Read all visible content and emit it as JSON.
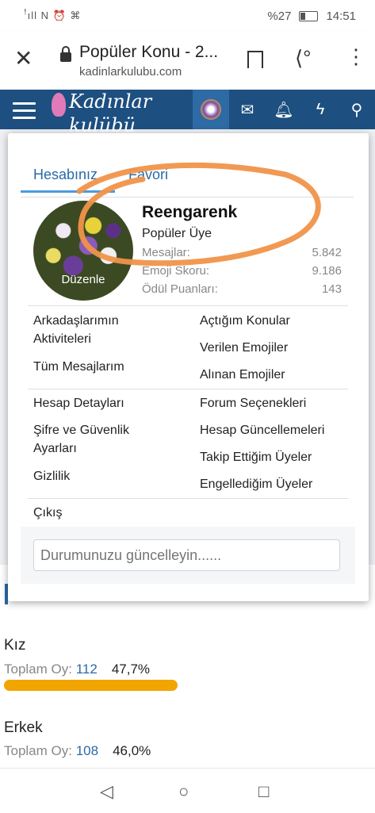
{
  "status_bar": {
    "signal": "ꜝıll N ⏰ ⌘",
    "battery": "%27",
    "time": "14:51"
  },
  "browser": {
    "title": "Popüler Konu - 2...",
    "host": "kadinlarkulubu.com"
  },
  "site": {
    "logo_line1": "Kadınlar",
    "logo_line2": "kulübü"
  },
  "popup": {
    "tabs": [
      "Hesabınız",
      "Favori"
    ],
    "avatar_edit": "Düzenle",
    "username": "Reengarenk",
    "role": "Popüler Üye",
    "stats": [
      {
        "label": "Mesajlar:",
        "value": "5.842"
      },
      {
        "label": "Emoji Skoru:",
        "value": "9.186"
      },
      {
        "label": "Ödül Puanları:",
        "value": "143"
      }
    ],
    "group1_left": [
      "Arkadaşlarımın Aktiviteleri",
      "Tüm Mesajlarım"
    ],
    "group1_right": [
      "Açtığım Konular",
      "Verilen Emojiler",
      "Alınan Emojiler"
    ],
    "group2_left": [
      "Hesap Detayları",
      "Şifre ve Güvenlik Ayarları",
      "Gizlilik"
    ],
    "group2_right": [
      "Forum Seçenekleri",
      "Hesap Güncellemeleri",
      "Takip Ettiğim Üyeler",
      "Engellediğim Üyeler"
    ],
    "logout": "Çıkış",
    "status_placeholder": "Durumunuzu güncelleyin......"
  },
  "poll": {
    "options": [
      {
        "label": "Kız",
        "prefix": "Toplam Oy:",
        "votes": "112",
        "percent": "47,7%"
      },
      {
        "label": "Erkek",
        "prefix": "Toplam Oy:",
        "votes": "108",
        "percent": "46,0%"
      }
    ],
    "bar_fraction": 0.477
  },
  "colors": {
    "header": "#1d4f80",
    "accent": "#2a6aa8",
    "bar": "#f0a500",
    "scribble": "#f0934a"
  }
}
